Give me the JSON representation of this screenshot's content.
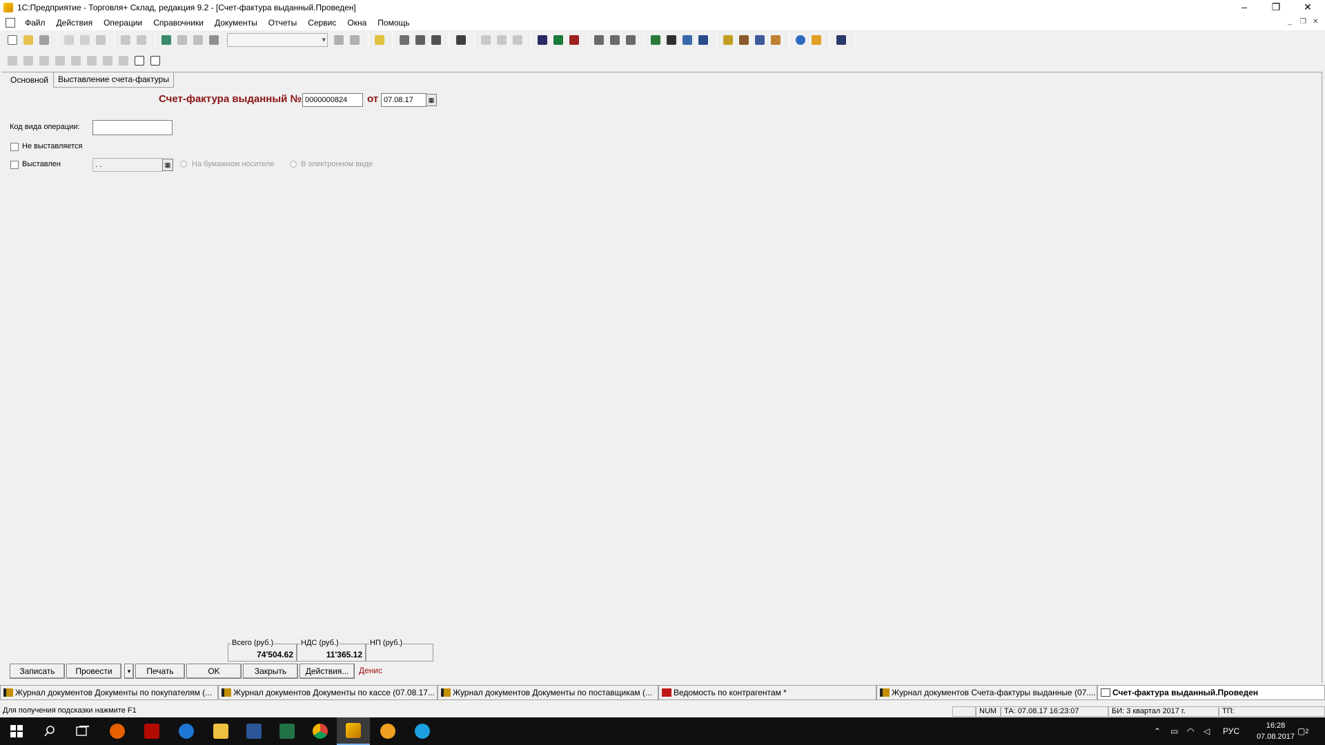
{
  "window": {
    "title": "1С:Предприятие - Торговля+ Склад, редакция 9.2 - [Счет-фактура выданный.Проведен]",
    "minimize_label": "–",
    "restore_label": "❐",
    "close_label": "✕"
  },
  "menu": {
    "items": [
      "Файл",
      "Действия",
      "Операции",
      "Справочники",
      "Документы",
      "Отчеты",
      "Сервис",
      "Окна",
      "Помощь"
    ]
  },
  "tabs": [
    "Основной",
    "Выставление счета-фактуры"
  ],
  "form": {
    "heading": "Счет-фактура выданный №",
    "number": "0000000824",
    "ot_label": "от",
    "date": "07.08.17",
    "op_code_label": "Код вида операции:",
    "op_code_value": "",
    "not_issued_label": "Не выставляется",
    "issued_label": "Выставлен",
    "issued_date": ". .",
    "paper_label": "На бумажном носителе",
    "electronic_label": "В электронном виде"
  },
  "totals": {
    "total_label": "Всего (руб.)",
    "total_value": "74'504.62",
    "vat_label": "НДС (руб.)",
    "vat_value": "11'365.12",
    "np_label": "НП (руб.)",
    "np_value": ""
  },
  "buttons": {
    "save": "Записать",
    "post": "Провести",
    "print": "Печать",
    "ok": "OK",
    "close": "Закрыть",
    "actions": "Действия..."
  },
  "user": "Денис",
  "window_list": [
    {
      "label": "Журнал документов  Документы по покупателям (...",
      "icon": "journal-icon"
    },
    {
      "label": "Журнал документов  Документы по кассе (07.08.17...",
      "icon": "journal-icon"
    },
    {
      "label": "Журнал документов  Документы по поставщикам (...",
      "icon": "journal-icon"
    },
    {
      "label": "Ведомость по контрагентам  *",
      "icon": "report-icon"
    },
    {
      "label": "Журнал документов  Счета-фактуры выданные (07....",
      "icon": "journal-icon"
    },
    {
      "label": "Счет-фактура выданный.Проведен",
      "icon": "document-icon"
    }
  ],
  "statusbar": {
    "hint": "Для получения подсказки нажмите F1",
    "num": "NUM",
    "ta": "ТА: 07.08.17  16:23:07",
    "bi": "БИ: 3 квартал 2017 г.",
    "tp": "ТП:"
  },
  "taskbar": {
    "lang": "РУС",
    "time": "16:28",
    "date": "07.08.2017",
    "notifications": "2",
    "apps": [
      "start-icon",
      "search-icon",
      "task-view-icon",
      "firefox-icon",
      "acrobat-icon",
      "edge-icon",
      "explorer-icon",
      "word-icon",
      "excel-icon",
      "chrome-icon",
      "1c-enterprise-icon",
      "1c-icon",
      "ie-icon"
    ]
  }
}
